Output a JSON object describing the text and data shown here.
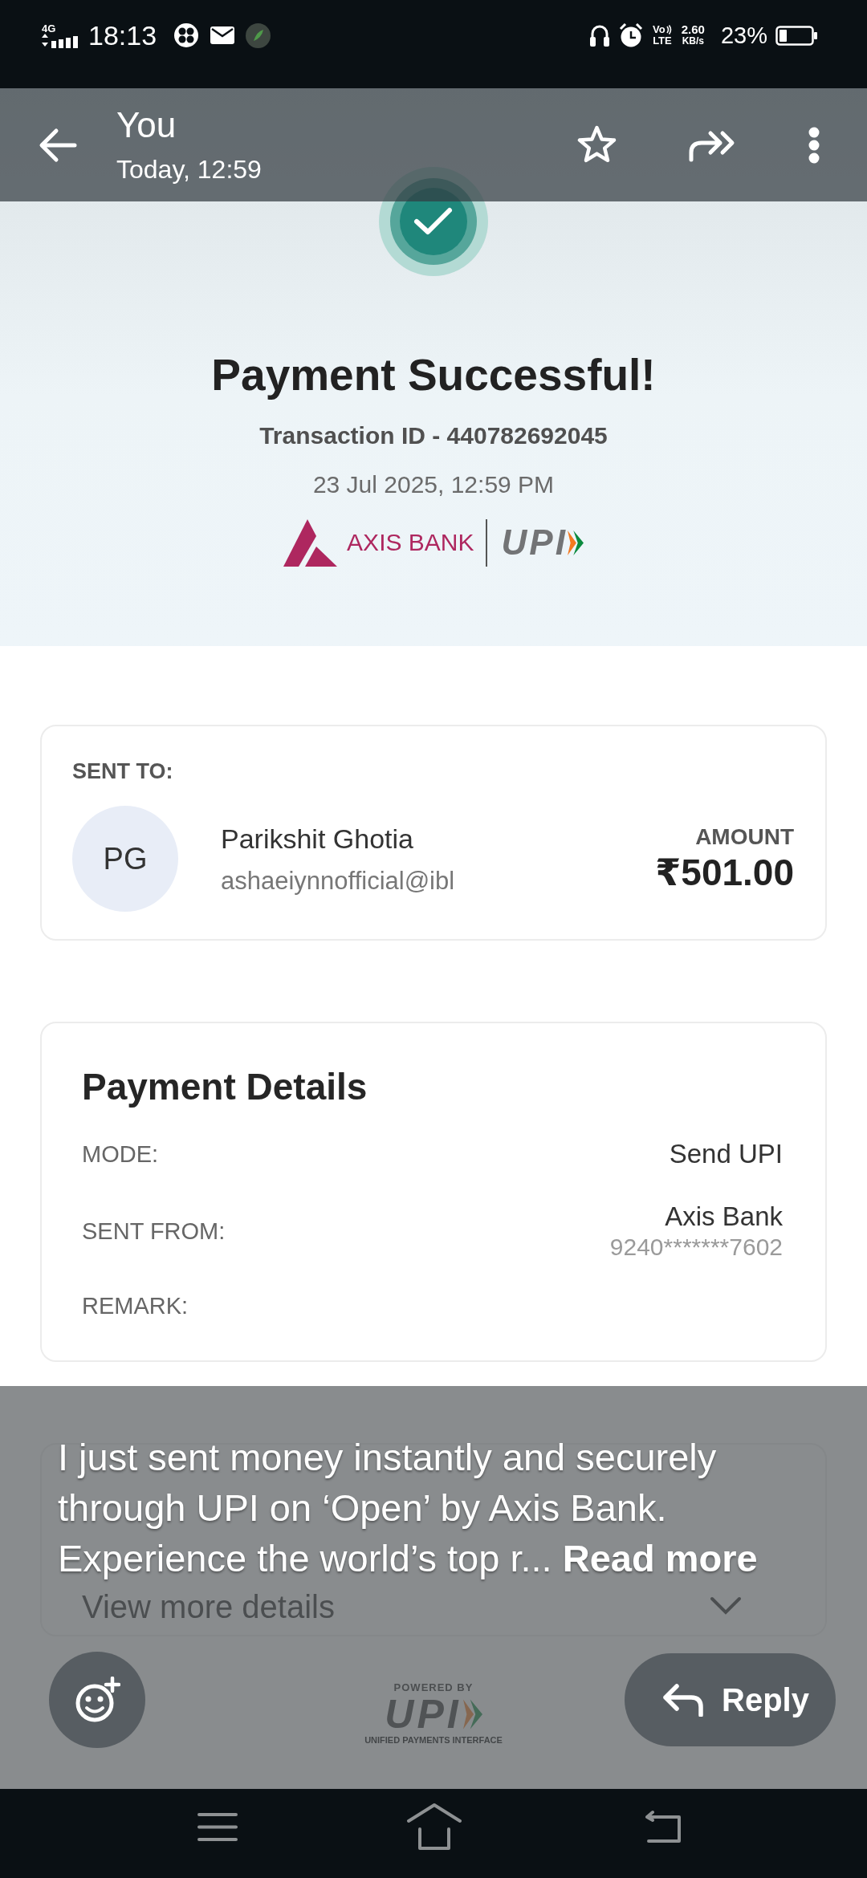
{
  "status_bar": {
    "network": "4G",
    "time": "18:13",
    "volte": {
      "top": "Vo",
      "bottom": "LTE"
    },
    "speed": {
      "value": "2.60",
      "unit": "KB/s"
    },
    "battery": "23%"
  },
  "header": {
    "title": "You",
    "subtitle": "Today, 12:59"
  },
  "receipt": {
    "title": "Payment Successful!",
    "transaction": "Transaction ID - 440782692045",
    "datetime": "23 Jul 2025, 12:59 PM",
    "bank_logo": "AXIS BANK",
    "upi_logo": "UPI",
    "recipient": {
      "label": "SENT TO:",
      "initials": "PG",
      "name": "Parikshit Ghotia",
      "upi_id": "ashaeiynnofficial@ibl",
      "amount_label": "AMOUNT",
      "amount": "₹501.00"
    },
    "details": {
      "title": "Payment Details",
      "rows": [
        {
          "label": "MODE:",
          "value": "Send UPI"
        },
        {
          "label": "SENT FROM:",
          "value": "Axis Bank",
          "subvalue": "9240*******7602"
        },
        {
          "label": "REMARK:"
        }
      ]
    },
    "more": {
      "label": "View more details"
    },
    "footer": {
      "top": "POWERED BY",
      "logo": "UPI",
      "bottom": "UNIFIED PAYMENTS INTERFACE"
    }
  },
  "message": {
    "caption": "I just sent money instantly and securely through UPI on ‘Open’ by Axis Bank. Experience the world’s top r...",
    "link": "Read more",
    "reply": "Reply"
  }
}
